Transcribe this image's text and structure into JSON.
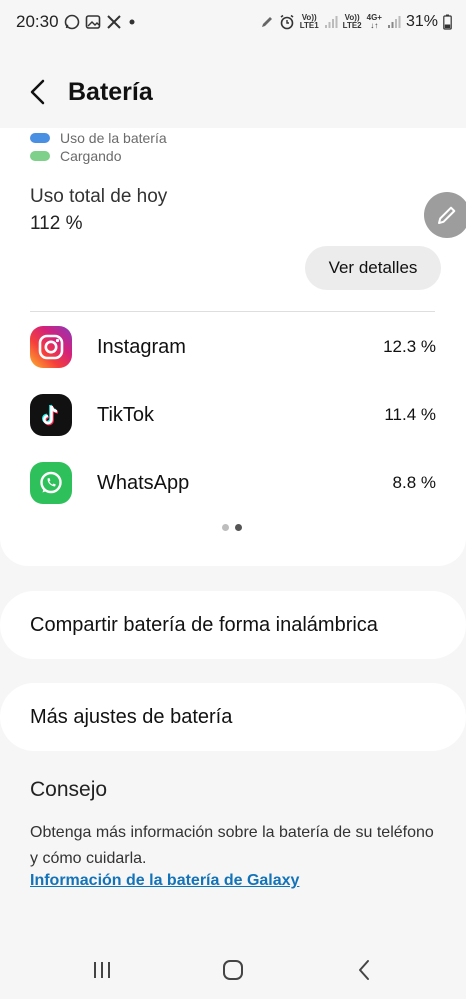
{
  "status": {
    "time": "20:30",
    "battery_pct": "31%",
    "sim1": {
      "top": "Vo))",
      "bottom": "LTE1"
    },
    "sim2": {
      "top": "Vo))",
      "bottom": "LTE2"
    },
    "net": "4G+"
  },
  "header": {
    "title": "Batería"
  },
  "legend": [
    {
      "label": "Uso de la batería",
      "color": "#4a90e2"
    },
    {
      "label": "Cargando",
      "color": "#7ed08a"
    }
  ],
  "usage": {
    "total_label": "Uso total de hoy",
    "total_value": "112 %",
    "details_button": "Ver detalles"
  },
  "apps": [
    {
      "name": "Instagram",
      "percent": "12.3 %",
      "icon": "instagram-icon"
    },
    {
      "name": "TikTok",
      "percent": "11.4 %",
      "icon": "tiktok-icon"
    },
    {
      "name": "WhatsApp",
      "percent": "8.8 %",
      "icon": "whatsapp-icon"
    }
  ],
  "menu": {
    "wireless_share": "Compartir batería de forma inalámbrica",
    "more_settings": "Más ajustes de batería"
  },
  "tips": {
    "title": "Consejo",
    "text": "Obtenga más información sobre la batería de su teléfono y cómo cuidarla.",
    "link": "Información de la batería de Galaxy"
  }
}
